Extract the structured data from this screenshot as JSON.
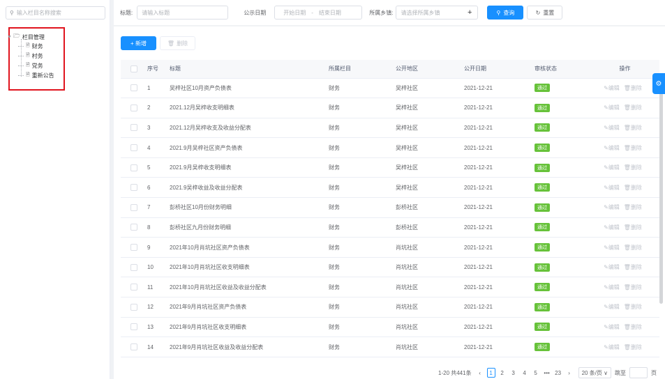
{
  "tree": {
    "search_placeholder": "输入栏目名称搜索",
    "root_label": "栏目管理",
    "children": [
      "财务",
      "村务",
      "党务",
      "重新公告"
    ]
  },
  "filters": {
    "title_label": "标题:",
    "title_placeholder": "请输入标题",
    "date_label": "公示日期",
    "date_start_placeholder": "开始日期",
    "date_sep": "-",
    "date_end_placeholder": "结束日期",
    "village_label": "所属乡镇:",
    "village_placeholder": "请选择所属乡镇",
    "plus": "+",
    "query_button": "查询",
    "reset_button": "重置"
  },
  "toolbar": {
    "add_button": "+ 新增",
    "delete_button": "删除"
  },
  "table": {
    "columns": [
      "序号",
      "标题",
      "所属栏目",
      "公开地区",
      "公开日期",
      "审核状态",
      "操作"
    ],
    "rows": [
      {
        "no": "1",
        "title": "吴梓社区10月资产负债表",
        "column": "财务",
        "region": "吴梓社区",
        "date": "2021-12-21",
        "status": "通过"
      },
      {
        "no": "2",
        "title": "2021.12月吴梓收支明细表",
        "column": "财务",
        "region": "吴梓社区",
        "date": "2021-12-21",
        "status": "通过"
      },
      {
        "no": "3",
        "title": "2021.12月吴梓收支及收益分配表",
        "column": "财务",
        "region": "吴梓社区",
        "date": "2021-12-21",
        "status": "通过"
      },
      {
        "no": "4",
        "title": "2021.9月吴梓社区资产负债表",
        "column": "财务",
        "region": "吴梓社区",
        "date": "2021-12-21",
        "status": "通过"
      },
      {
        "no": "5",
        "title": "2021.9月吴梓收支明细表",
        "column": "财务",
        "region": "吴梓社区",
        "date": "2021-12-21",
        "status": "通过"
      },
      {
        "no": "6",
        "title": "2021.9吴梓收益及收益分配表",
        "column": "财务",
        "region": "吴梓社区",
        "date": "2021-12-21",
        "status": "通过"
      },
      {
        "no": "7",
        "title": "彭桥社区10月份财务明细",
        "column": "财务",
        "region": "彭桥社区",
        "date": "2021-12-21",
        "status": "通过"
      },
      {
        "no": "8",
        "title": "彭桥社区九月份财务明细",
        "column": "财务",
        "region": "彭桥社区",
        "date": "2021-12-21",
        "status": "通过"
      },
      {
        "no": "9",
        "title": "2021年10月肖坑社区资产负债表",
        "column": "财务",
        "region": "肖坑社区",
        "date": "2021-12-21",
        "status": "通过"
      },
      {
        "no": "10",
        "title": "2021年10月肖坑社区收支明细表",
        "column": "财务",
        "region": "肖坑社区",
        "date": "2021-12-21",
        "status": "通过"
      },
      {
        "no": "11",
        "title": "2021年10月肖坑社区收益及收益分配表",
        "column": "财务",
        "region": "肖坑社区",
        "date": "2021-12-21",
        "status": "通过"
      },
      {
        "no": "12",
        "title": "2021年9月肖坑社区资产负债表",
        "column": "财务",
        "region": "肖坑社区",
        "date": "2021-12-21",
        "status": "通过"
      },
      {
        "no": "13",
        "title": "2021年9月肖坑社区收支明细表",
        "column": "财务",
        "region": "肖坑社区",
        "date": "2021-12-21",
        "status": "通过"
      },
      {
        "no": "14",
        "title": "2021年9月肖坑社区收益及收益分配表",
        "column": "财务",
        "region": "肖坑社区",
        "date": "2021-12-21",
        "status": "通过"
      }
    ],
    "edit_label": "编辑",
    "delete_label": "删除"
  },
  "pagination": {
    "summary": "1-20 共441条",
    "pages": [
      "1",
      "2",
      "3",
      "4",
      "5",
      "•••",
      "23"
    ],
    "active_page": "1",
    "page_size": "20 条/页",
    "goto_label": "跳至",
    "page_suffix": "页"
  }
}
